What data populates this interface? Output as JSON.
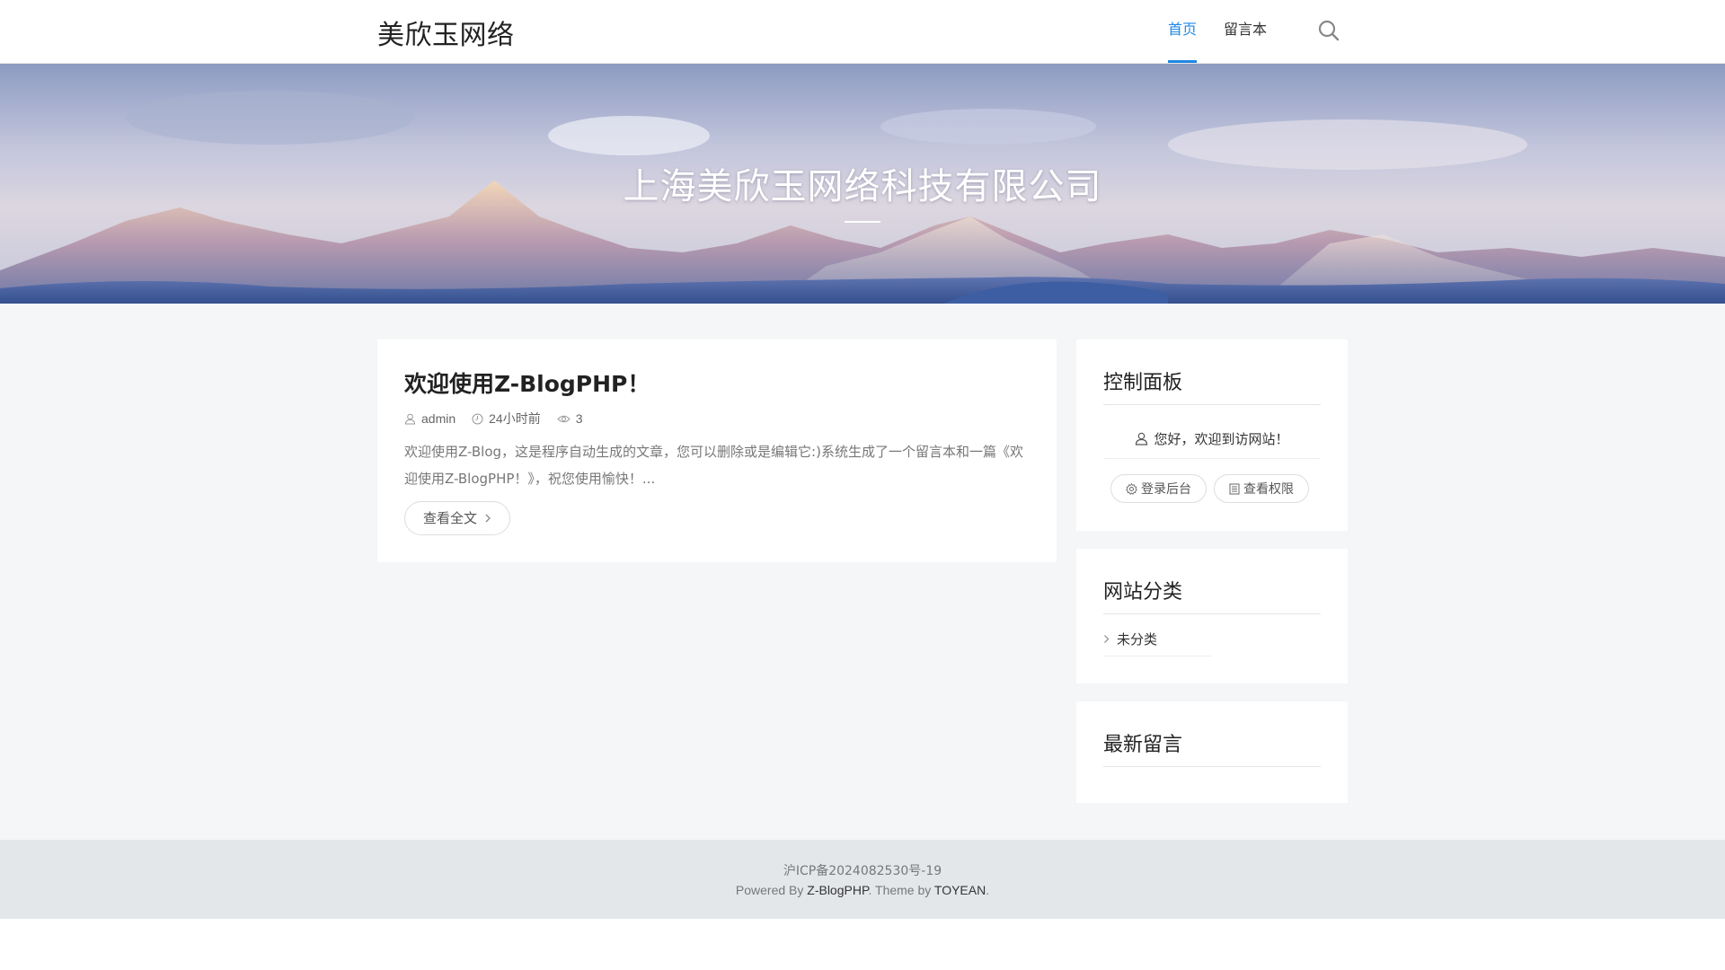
{
  "header": {
    "site_title": "美欣玉网络",
    "nav": [
      {
        "label": "首页",
        "active": true
      },
      {
        "label": "留言本",
        "active": false
      }
    ],
    "search_icon": "search-icon"
  },
  "banner": {
    "title": "上海美欣玉网络科技有限公司"
  },
  "post": {
    "title": "欢迎使用Z-BlogPHP！",
    "author": "admin",
    "time": "24小时前",
    "views": "3",
    "excerpt": "欢迎使用Z-Blog，这是程序自动生成的文章，您可以删除或是编辑它:)系统生成了一个留言本和一篇《欢迎使用Z-BlogPHP！》，祝您使用愉快！...",
    "read_more": "查看全文"
  },
  "sidebar": {
    "control_panel": {
      "title": "控制面板",
      "welcome": "您好，欢迎到访网站！",
      "login_label": "登录后台",
      "permission_label": "查看权限"
    },
    "categories": {
      "title": "网站分类",
      "items": [
        {
          "label": "未分类"
        }
      ]
    },
    "latest_comments": {
      "title": "最新留言"
    }
  },
  "footer": {
    "icp": "沪ICP备2024082530号-19",
    "powered_prefix": "Powered By ",
    "powered_link": "Z-BlogPHP",
    "theme_prefix": ". Theme by ",
    "theme_link": "TOYEAN",
    "suffix": "."
  },
  "colors": {
    "accent": "#1e88e5",
    "background": "#f5f6f7",
    "footer_bg": "#e4e7ea"
  }
}
